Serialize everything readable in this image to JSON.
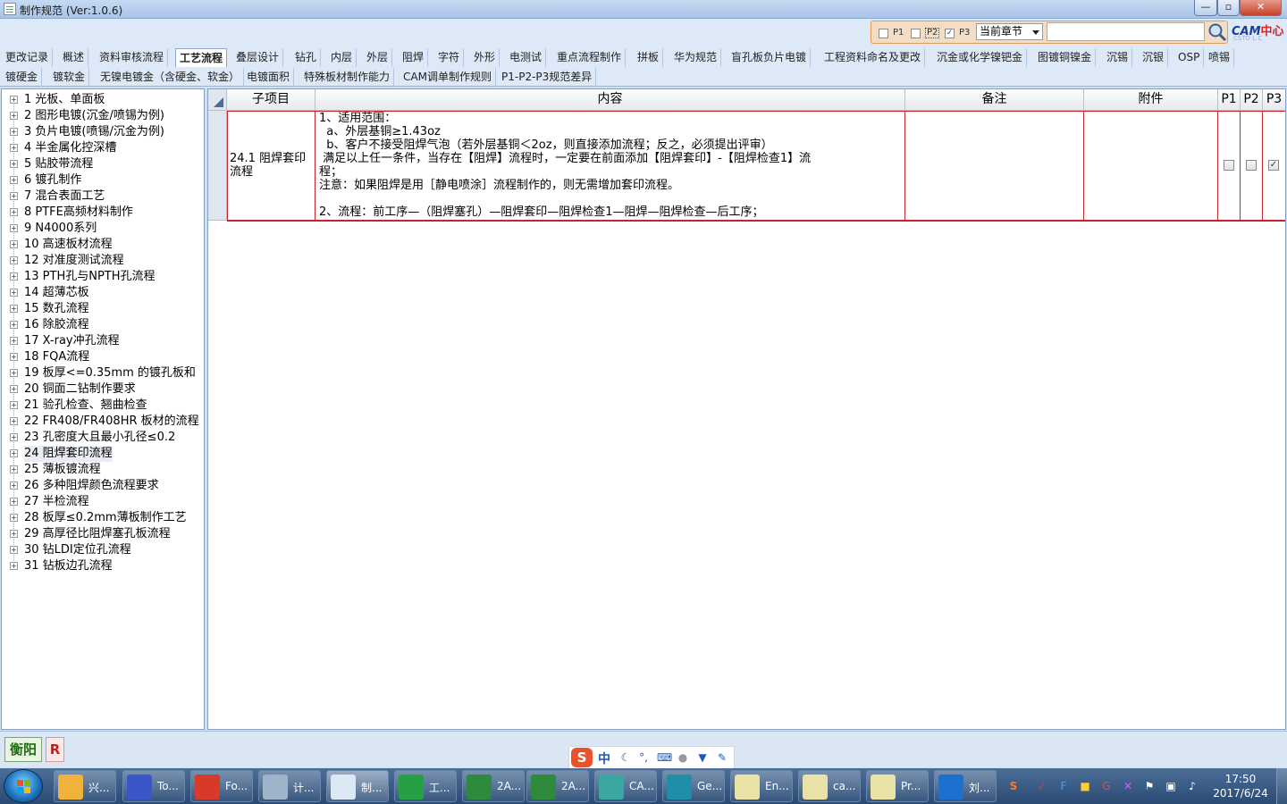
{
  "window": {
    "title": "制作规范 (Ver:1.0.6)"
  },
  "filters": {
    "p1": {
      "label": "P1",
      "checked": false
    },
    "p2": {
      "label": "P2",
      "checked": false
    },
    "p3": {
      "label": "P3",
      "checked": true
    },
    "chapter_select": "当前章节",
    "search_value": ""
  },
  "logo": {
    "text": "CAM",
    "cn": "中心"
  },
  "tabs_row1": [
    "更改记录",
    "概述",
    "资料审核流程",
    "工艺流程",
    "叠层设计",
    "钻孔",
    "内层",
    "外层",
    "阻焊",
    "字符",
    "外形",
    "电测试",
    "重点流程制作",
    "拼板",
    "华为规范",
    "盲孔板负片电镀",
    "工程资料命名及更改",
    "沉金或化学镍钯金",
    "图镀铜镍金",
    "沉锡",
    "沉银",
    "OSP",
    "喷锡"
  ],
  "tabs_row2": [
    "镀硬金",
    "镀软金",
    "无镍电镀金（含硬金、软金）",
    "电镀面积",
    "特殊板材制作能力",
    "CAM调单制作规则",
    "P1-P2-P3规范差异"
  ],
  "active_tab": "工艺流程",
  "tree": [
    "1 光板、单面板",
    "2 图形电镀(沉金/喷锡为例)",
    "3 负片电镀(喷锡/沉金为例)",
    "4 半金属化控深槽",
    "5 贴胶带流程",
    "6 镀孔制作",
    "7 混合表面工艺",
    "8 PTFE高频材料制作",
    "9 N4000系列",
    "10 高速板材流程",
    "12 对准度测试流程",
    "13 PTH孔与NPTH孔流程",
    "14 超薄芯板",
    "15 数孔流程",
    "16 除胶流程",
    "17 X-ray冲孔流程",
    "18 FQA流程",
    "19 板厚<=0.35mm 的镀孔板和",
    "20 铜面二钻制作要求",
    "21 验孔检查、翘曲检查",
    "22 FR408/FR408HR 板材的流程",
    "23 孔密度大且最小孔径≤0.2",
    "24 阻焊套印流程",
    "25 薄板镀流程",
    "26 多种阻焊颜色流程要求",
    "27 半检流程",
    "28 板厚≤0.2mm薄板制作工艺",
    "29 高厚径比阻焊塞孔板流程",
    "30 钻LDI定位孔流程",
    "31 钻板边孔流程"
  ],
  "tree_selected_index": 22,
  "grid": {
    "headers": {
      "sub": "子项目",
      "content": "内容",
      "note": "备注",
      "attach": "附件",
      "p1": "P1",
      "p2": "P2",
      "p3": "P3"
    },
    "row": {
      "sub": "24.1 阻焊套印流程",
      "content_lines": [
        "1、适用范围：",
        "  a、外层基铜≥1.43oz",
        "  b、客户不接受阻焊气泡（若外层基铜＜2oz，则直接添加流程；反之，必须提出评审）",
        " 满足以上任一条件，当存在【阻焊】流程时，一定要在前面添加【阻焊套印】-【阻焊检查1】流",
        "程；",
        "注意：如果阻焊是用［静电喷涂］流程制作的，则无需增加套印流程。",
        "",
        "2、流程：前工序—（阻焊塞孔）—阻焊套印—阻焊检查1—阻焊—阻焊检查—后工序；"
      ],
      "note": "",
      "attach": "",
      "p1": false,
      "p2": false,
      "p3": true
    }
  },
  "status": {
    "city": "衡阳",
    "r_badge": "R"
  },
  "ime": {
    "logo": "S",
    "mode": "中"
  },
  "taskbar": {
    "items": [
      {
        "label": "兴...",
        "color": "#f0b23a"
      },
      {
        "label": "To...",
        "color": "#3a57c8"
      },
      {
        "label": "Fo...",
        "color": "#d83a2a"
      },
      {
        "label": "计...",
        "color": "#9fb3c9"
      },
      {
        "label": "制...",
        "color": "#dce8f4"
      },
      {
        "label": "工...",
        "color": "#25a144"
      },
      {
        "label": "2A...",
        "color": "#2e8a3d"
      },
      {
        "label": "2A...",
        "color": "#2e8a3d"
      },
      {
        "label": "CA...",
        "color": "#3aa8a0"
      },
      {
        "label": "Ge...",
        "color": "#1f8fa7"
      },
      {
        "label": "En...",
        "color": "#e9e1a5"
      },
      {
        "label": "ca...",
        "color": "#e9e1a5"
      },
      {
        "label": "Pr...",
        "color": "#e9e1a5"
      },
      {
        "label": "刘...",
        "color": "#1f6fcf"
      }
    ],
    "clock_time": "17:50",
    "clock_date": "2017/6/24"
  }
}
